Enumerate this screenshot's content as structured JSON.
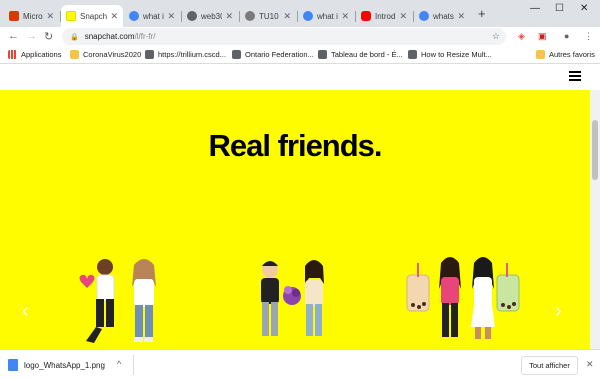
{
  "tabs": [
    {
      "title": "Micros",
      "icon": "office-icon",
      "color": "#d83b01"
    },
    {
      "title": "Snapch",
      "icon": "snapchat-icon",
      "color": "#fffc00",
      "active": true
    },
    {
      "title": "what is",
      "icon": "google-icon",
      "color": "#4285f4"
    },
    {
      "title": "web30(",
      "icon": "globe-icon",
      "color": "#5f6368"
    },
    {
      "title": "TU10 -",
      "icon": "page-icon",
      "color": "#7b7b7b"
    },
    {
      "title": "what is",
      "icon": "google-icon",
      "color": "#4285f4"
    },
    {
      "title": "Introdu",
      "icon": "youtube-icon",
      "color": "#ff0000"
    },
    {
      "title": "whatsa",
      "icon": "google-icon",
      "color": "#4285f4"
    }
  ],
  "toolbar": {
    "url_host": "snapchat.com",
    "url_path": "/l/fr-fr/"
  },
  "bookmarks": [
    {
      "label": "Applications",
      "icon": "apps-grid-icon"
    },
    {
      "label": "CoronaVirus2020",
      "icon": "folder-icon"
    },
    {
      "label": "https://trillium.cscd...",
      "icon": "page-icon"
    },
    {
      "label": "Ontario Federation...",
      "icon": "globe-icon"
    },
    {
      "label": "Tableau de bord - É...",
      "icon": "globe-icon"
    },
    {
      "label": "How to Resize Mult...",
      "icon": "globe-icon"
    },
    {
      "label": "Autres favoris",
      "icon": "folder-icon"
    }
  ],
  "hero": {
    "headline": "Real friends."
  },
  "download": {
    "filename": "logo_WhatsApp_1.png",
    "show_all": "Tout afficher"
  },
  "colors": {
    "snap_yellow": "#fffc00",
    "tab_strip": "#dee1e6"
  }
}
